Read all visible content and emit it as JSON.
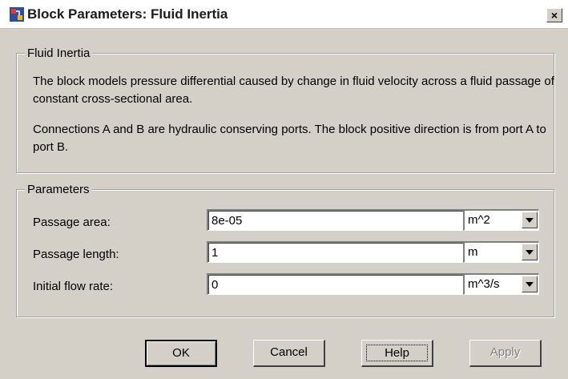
{
  "window": {
    "title": "Block Parameters: Fluid Inertia",
    "close_glyph": "×"
  },
  "description_group": {
    "legend": "Fluid Inertia",
    "paragraph1": "The block models pressure differential caused by change in fluid velocity across a fluid passage of constant cross-sectional area.",
    "paragraph2": "Connections A and B are hydraulic conserving ports. The block positive direction is from port A to port B."
  },
  "parameters_group": {
    "legend": "Parameters",
    "rows": [
      {
        "label": "Passage area:",
        "value": "8e-05",
        "unit": "m^2"
      },
      {
        "label": "Passage length:",
        "value": "1",
        "unit": "m"
      },
      {
        "label": "Initial flow rate:",
        "value": "0",
        "unit": "m^3/s"
      }
    ]
  },
  "buttons": {
    "ok": "OK",
    "cancel": "Cancel",
    "help": "Help",
    "apply": "Apply"
  },
  "icons": {
    "title": "simulink-block-icon",
    "close": "close-icon",
    "dropdown": "chevron-down-icon"
  },
  "colors": {
    "dialog_bg": "#d4d0c8",
    "disabled_text": "#808080"
  }
}
